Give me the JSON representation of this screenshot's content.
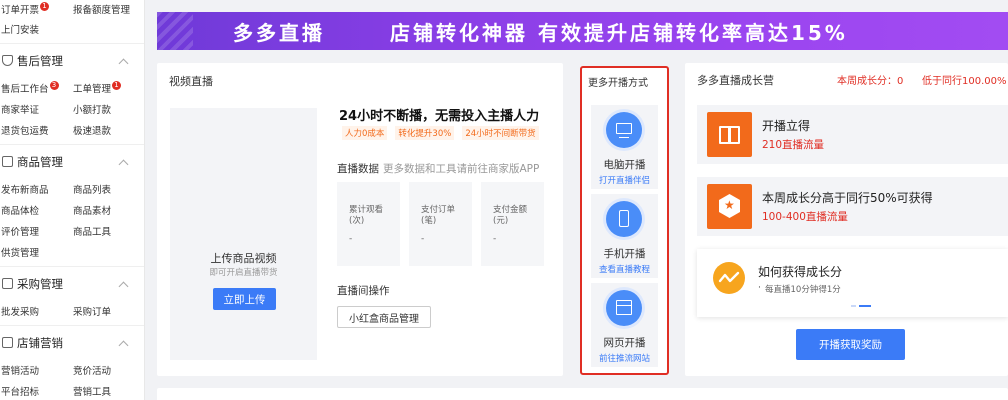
{
  "sidebar": {
    "top_rows": [
      {
        "c1": "订单开票",
        "c1_badge": "1",
        "c2": "报备额度管理"
      },
      {
        "c1": "上门安装",
        "c2": ""
      }
    ],
    "sections": [
      {
        "title": "售后管理",
        "icon": "shield-check-icon",
        "rows": [
          {
            "c1": "售后工作台",
            "c1_badge": "3",
            "c2": "工单管理",
            "c2_badge": "1"
          },
          {
            "c1": "商家举证",
            "c2": "小额打款"
          },
          {
            "c1": "退货包运费",
            "c2": "极速退款"
          }
        ]
      },
      {
        "title": "商品管理",
        "icon": "product-icon",
        "rows": [
          {
            "c1": "发布新商品",
            "c2": "商品列表"
          },
          {
            "c1": "商品体检",
            "c2": "商品素材"
          },
          {
            "c1": "评价管理",
            "c2": "商品工具"
          },
          {
            "c1": "供货管理",
            "c2": ""
          }
        ]
      },
      {
        "title": "采购管理",
        "icon": "purchase-icon",
        "rows": [
          {
            "c1": "批发采购",
            "c2": "采购订单"
          }
        ]
      },
      {
        "title": "店铺营销",
        "icon": "marketing-icon",
        "rows": [
          {
            "c1": "营销活动",
            "c2": "竞价活动"
          },
          {
            "c1": "平台招标",
            "c2": "营销工具"
          }
        ]
      }
    ]
  },
  "banner": {
    "part1": "多多直播",
    "part2": "店铺转化神器 有效提升店铺转化率高达15%"
  },
  "live": {
    "title": "视频直播",
    "upload_title": "上传商品视频",
    "upload_sub": "即可开启直播带货",
    "upload_button": "立即上传",
    "headline": "24小时不断播，无需投入主播人力",
    "tags": [
      "人力0成本",
      "转化提升30%",
      "24小时不间断带货"
    ],
    "data_label": "直播数据",
    "data_sub": "更多数据和工具请前往商家版APP",
    "stats": [
      {
        "label": "累计观看\n(次)",
        "value": "-"
      },
      {
        "label": "支付订单\n(笔)",
        "value": "-"
      },
      {
        "label": "支付金额\n(元)",
        "value": "-"
      }
    ],
    "op_title": "直播间操作",
    "op_button": "小红盒商品管理"
  },
  "more": {
    "title": "更多开播方式",
    "items": [
      {
        "title": "电脑开播",
        "link": "打开直播伴侣",
        "icon": "monitor-icon"
      },
      {
        "title": "手机开播",
        "link": "查看直播教程",
        "icon": "phone-icon"
      },
      {
        "title": "网页开播",
        "link": "前往推流网站",
        "icon": "web-page-icon"
      }
    ]
  },
  "grow": {
    "title": "多多直播成长营",
    "week_growth": "本周成长分：0",
    "peer_compare": "低于同行100.00%",
    "items": [
      {
        "title": "开播立得",
        "sub": "210直播流量",
        "icon": "gift-box-icon"
      },
      {
        "title": "本周成长分高于同行50%可获得",
        "sub": "100-400直播流量",
        "icon": "star-badge-icon"
      }
    ],
    "how_title": "如何获得成长分",
    "how_bullet": "·",
    "how_sub": "每直播10分钟得1分",
    "reward_button": "开播获取奖励"
  },
  "colors": {
    "accent": "#3b7bf7",
    "alert_red": "#e02e24",
    "orange": "#f26a1b",
    "banner_purple": "#8a3ee6"
  }
}
